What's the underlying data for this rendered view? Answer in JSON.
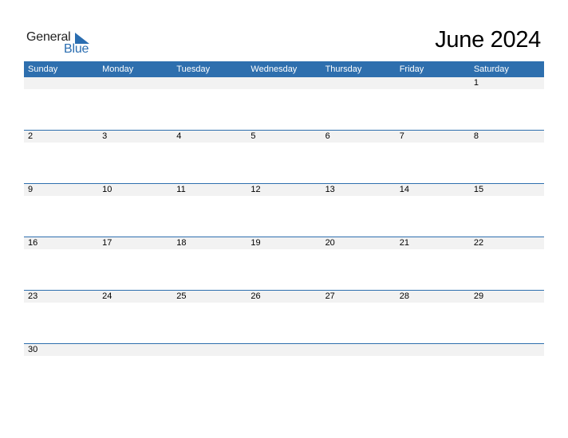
{
  "logo": {
    "word1": "General",
    "word2": "Blue",
    "mark": "blue-triangle-logo-mark"
  },
  "title": "June 2024",
  "colors": {
    "accent": "#2e6fae",
    "row_band": "#f2f2f2"
  },
  "weekdays": [
    "Sunday",
    "Monday",
    "Tuesday",
    "Wednesday",
    "Thursday",
    "Friday",
    "Saturday"
  ],
  "weeks": [
    [
      "",
      "",
      "",
      "",
      "",
      "",
      "1"
    ],
    [
      "2",
      "3",
      "4",
      "5",
      "6",
      "7",
      "8"
    ],
    [
      "9",
      "10",
      "11",
      "12",
      "13",
      "14",
      "15"
    ],
    [
      "16",
      "17",
      "18",
      "19",
      "20",
      "21",
      "22"
    ],
    [
      "23",
      "24",
      "25",
      "26",
      "27",
      "28",
      "29"
    ],
    [
      "30",
      "",
      "",
      "",
      "",
      "",
      ""
    ]
  ]
}
